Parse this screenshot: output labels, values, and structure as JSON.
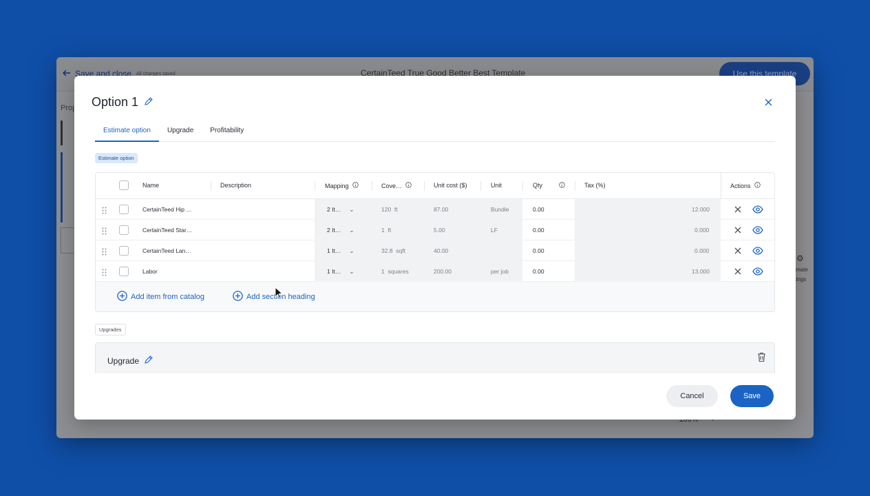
{
  "background": {
    "save_close": "Save and close",
    "saved_status": "All changes saved",
    "template_title": "CertainTeed True Good Better Best Template",
    "use_template": "Use this template",
    "left_label": "Prop",
    "right_settings_line1": "timate",
    "right_settings_line2": "ttings",
    "zoom_minus": "−",
    "zoom_level": "100%",
    "zoom_plus": "+"
  },
  "modal": {
    "title": "Option 1",
    "tabs": [
      "Estimate option",
      "Upgrade",
      "Profitability"
    ],
    "active_tab": "Estimate option",
    "estimate_chip": "Estimate option",
    "upgrades_chip": "Upgrades",
    "table": {
      "headers": {
        "name": "Name",
        "description": "Description",
        "mapping": "Mapping",
        "coverage": "Cove…",
        "unit_cost": "Unit cost ($)",
        "unit": "Unit",
        "qty": "Qty",
        "tax": "Tax (%)",
        "actions": "Actions"
      },
      "rows": [
        {
          "name": "CertainTeed Hip …",
          "mapping": "2 It…",
          "coverage_value": "120",
          "coverage_unit": "ft",
          "unit_cost": "87.00",
          "unit": "Bundle",
          "qty": "0.00",
          "tax": "12.000"
        },
        {
          "name": "CertainTeed Star…",
          "mapping": "2 It…",
          "coverage_value": "1",
          "coverage_unit": "ft",
          "unit_cost": "5.00",
          "unit": "LF",
          "qty": "0.00",
          "tax": "0.000"
        },
        {
          "name": "CertainTeed Lan…",
          "mapping": "1 It…",
          "coverage_value": "32.8",
          "coverage_unit": "sqft",
          "unit_cost": "40.00",
          "unit": "",
          "qty": "0.00",
          "tax": "0.000"
        },
        {
          "name": "Labor",
          "mapping": "1 It…",
          "coverage_value": "1",
          "coverage_unit": "squares",
          "unit_cost": "200.00",
          "unit": "per job",
          "qty": "0.00",
          "tax": "13.000"
        }
      ]
    },
    "add_from_catalog": "Add item from catalog",
    "add_section_heading": "Add section heading",
    "upgrade_title": "Upgrade",
    "cancel": "Cancel",
    "save": "Save"
  },
  "colors": {
    "accent": "#1b63c5",
    "page_background": "#0f4fa8"
  }
}
